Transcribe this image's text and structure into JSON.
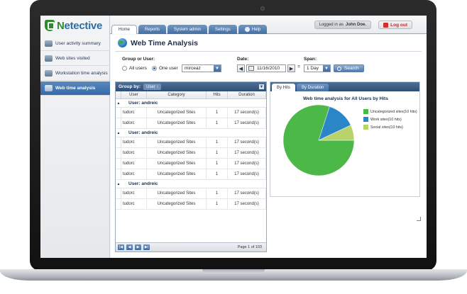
{
  "app": {
    "logo_text_prefix": "N",
    "logo_text_rest": "etective"
  },
  "sidebar": {
    "items": [
      {
        "label": "User activity summary",
        "icon": "user-activity-icon"
      },
      {
        "label": "Web sites visited",
        "icon": "websites-icon"
      },
      {
        "label": "Workstation time analysis",
        "icon": "workstation-icon"
      },
      {
        "label": "Web time analysis",
        "icon": "web-time-icon",
        "active": true
      }
    ]
  },
  "topbar": {
    "tabs": [
      "Home",
      "Reports",
      "System admin",
      "Settings",
      "Help"
    ],
    "login_prefix": "Logged in as",
    "login_user": "John Doe.",
    "logout_label": "Log out"
  },
  "page": {
    "title": "Web Time Analysis"
  },
  "filters": {
    "group_label": "Group or User:",
    "all_users_label": "All users",
    "one_user_label": "One user",
    "user_select_value": "mirceaz",
    "date_label": "Date:",
    "date_value": "11/16/2010",
    "span_label": "Span:",
    "span_value": "1 Day",
    "search_label": "Search"
  },
  "grid": {
    "group_by_label": "Group by:",
    "group_by_value": "User",
    "columns": [
      "User",
      "Category",
      "Hits",
      "Duration"
    ],
    "groups": [
      {
        "label": "User: andreic",
        "rows": [
          [
            "tudorc",
            "Uncategorized Sites",
            "1",
            "17 second(s)"
          ],
          [
            "tudorc",
            "Uncategorized Sites",
            "1",
            "17 second(s)"
          ]
        ]
      },
      {
        "label": "User: andreic",
        "rows": [
          [
            "tudorc",
            "Uncategorized Sites",
            "1",
            "17 second(s)"
          ],
          [
            "tudorc",
            "Uncategorized Sites",
            "1",
            "17 second(s)"
          ],
          [
            "tudorc",
            "Uncategorized Sites",
            "1",
            "17 second(s)"
          ],
          [
            "tudorc",
            "Uncategorized Sites",
            "1",
            "17 second(s)"
          ]
        ]
      },
      {
        "label": "User: andreic",
        "rows": [
          [
            "tudorc",
            "Uncategorized Sites",
            "1",
            "17 second(s)"
          ],
          [
            "tudorc",
            "Uncategorized Sites",
            "1",
            "17 second(s)"
          ]
        ]
      }
    ],
    "page_info": "Page 1 of 103"
  },
  "chart_panel": {
    "tabs": [
      "By Hits",
      "By Duration"
    ]
  },
  "chart_data": {
    "type": "pie",
    "title": "Web time analysis for All Users by Hits",
    "slices": [
      {
        "label": "Uncategorized sites(10 hits)",
        "value": 10,
        "color": "#4cb848"
      },
      {
        "label": "Work sites(10 hits)",
        "value": 10,
        "color": "#2b86c7"
      },
      {
        "label": "Social sites(10 hits)",
        "value": 10,
        "color": "#b9d36b"
      }
    ],
    "rendered_fractions": [
      0.8,
      0.13,
      0.07
    ]
  }
}
